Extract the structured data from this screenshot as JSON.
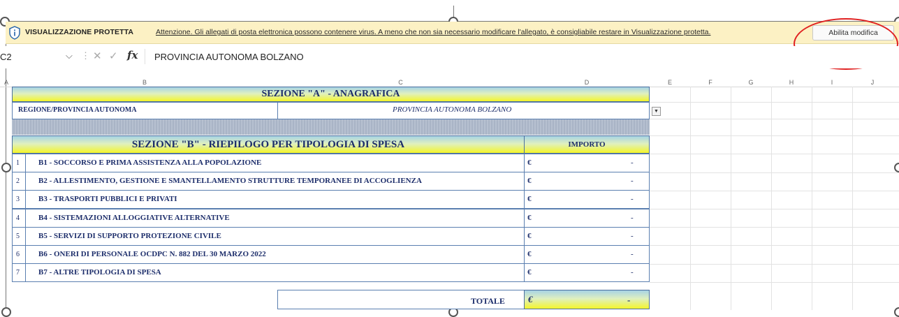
{
  "protected_view": {
    "title": "VISUALIZZAZIONE PROTETTA",
    "message": "Attenzione. Gli allegati di posta elettronica possono contenere virus. A meno che non sia necessario modificare l'allegato, è consigliabile restare in Visualizzazione protetta.",
    "enable_button": "Abilita modifica",
    "shield_icon": "shield-info-icon"
  },
  "formula_bar": {
    "name_box": "C2",
    "fx_label": "fx",
    "value": "PROVINCIA AUTONOMA BOLZANO"
  },
  "columns": [
    "A",
    "B",
    "C",
    "D",
    "E",
    "F",
    "G",
    "H",
    "I",
    "J"
  ],
  "sheet": {
    "section_a_title": "SEZIONE \"A\" - ANAGRAFICA",
    "region_label": "REGIONE/PROVINCIA AUTONOMA",
    "region_value": "PROVINCIA AUTONOMA BOLZANO",
    "section_b_title": "SEZIONE \"B\" - RIEPILOGO PER TIPOLOGIA DI SPESA",
    "importo_header": "IMPORTO",
    "currency": "€",
    "rows": [
      {
        "num": "1",
        "label": "B1 - SOCCORSO E PRIMA ASSISTENZA ALLA POPOLAZIONE",
        "amount": "-"
      },
      {
        "num": "2",
        "label": "B2 - ALLESTIMENTO, GESTIONE E SMANTELLAMENTO STRUTTURE TEMPORANEE DI ACCOGLIENZA",
        "amount": "-"
      },
      {
        "num": "3",
        "label": "B3 - TRASPORTI PUBBLICI E PRIVATI",
        "amount": "-"
      },
      {
        "num": "4",
        "label": "B4 - SISTEMAZIONI ALLOGGIATIVE ALTERNATIVE",
        "amount": "-"
      },
      {
        "num": "5",
        "label": "B5 - SERVIZI DI SUPPORTO PROTEZIONE CIVILE",
        "amount": "-"
      },
      {
        "num": "6",
        "label": "B6 - ONERI DI PERSONALE OCDPC N. 882 DEL 30 MARZO 2022",
        "amount": "-"
      },
      {
        "num": "7",
        "label": "B7 - ALTRE TIPOLOGIA DI SPESA",
        "amount": "-"
      }
    ],
    "total_label": "TOTALE",
    "total_amount": "-"
  },
  "colors": {
    "protected_bar": "#fcf1c4",
    "highlight_ellipse": "#e02020",
    "header_gradient_top": "#a7d3e4",
    "header_gradient_bottom": "#f4f52a",
    "text_navy": "#1d2e6b"
  }
}
